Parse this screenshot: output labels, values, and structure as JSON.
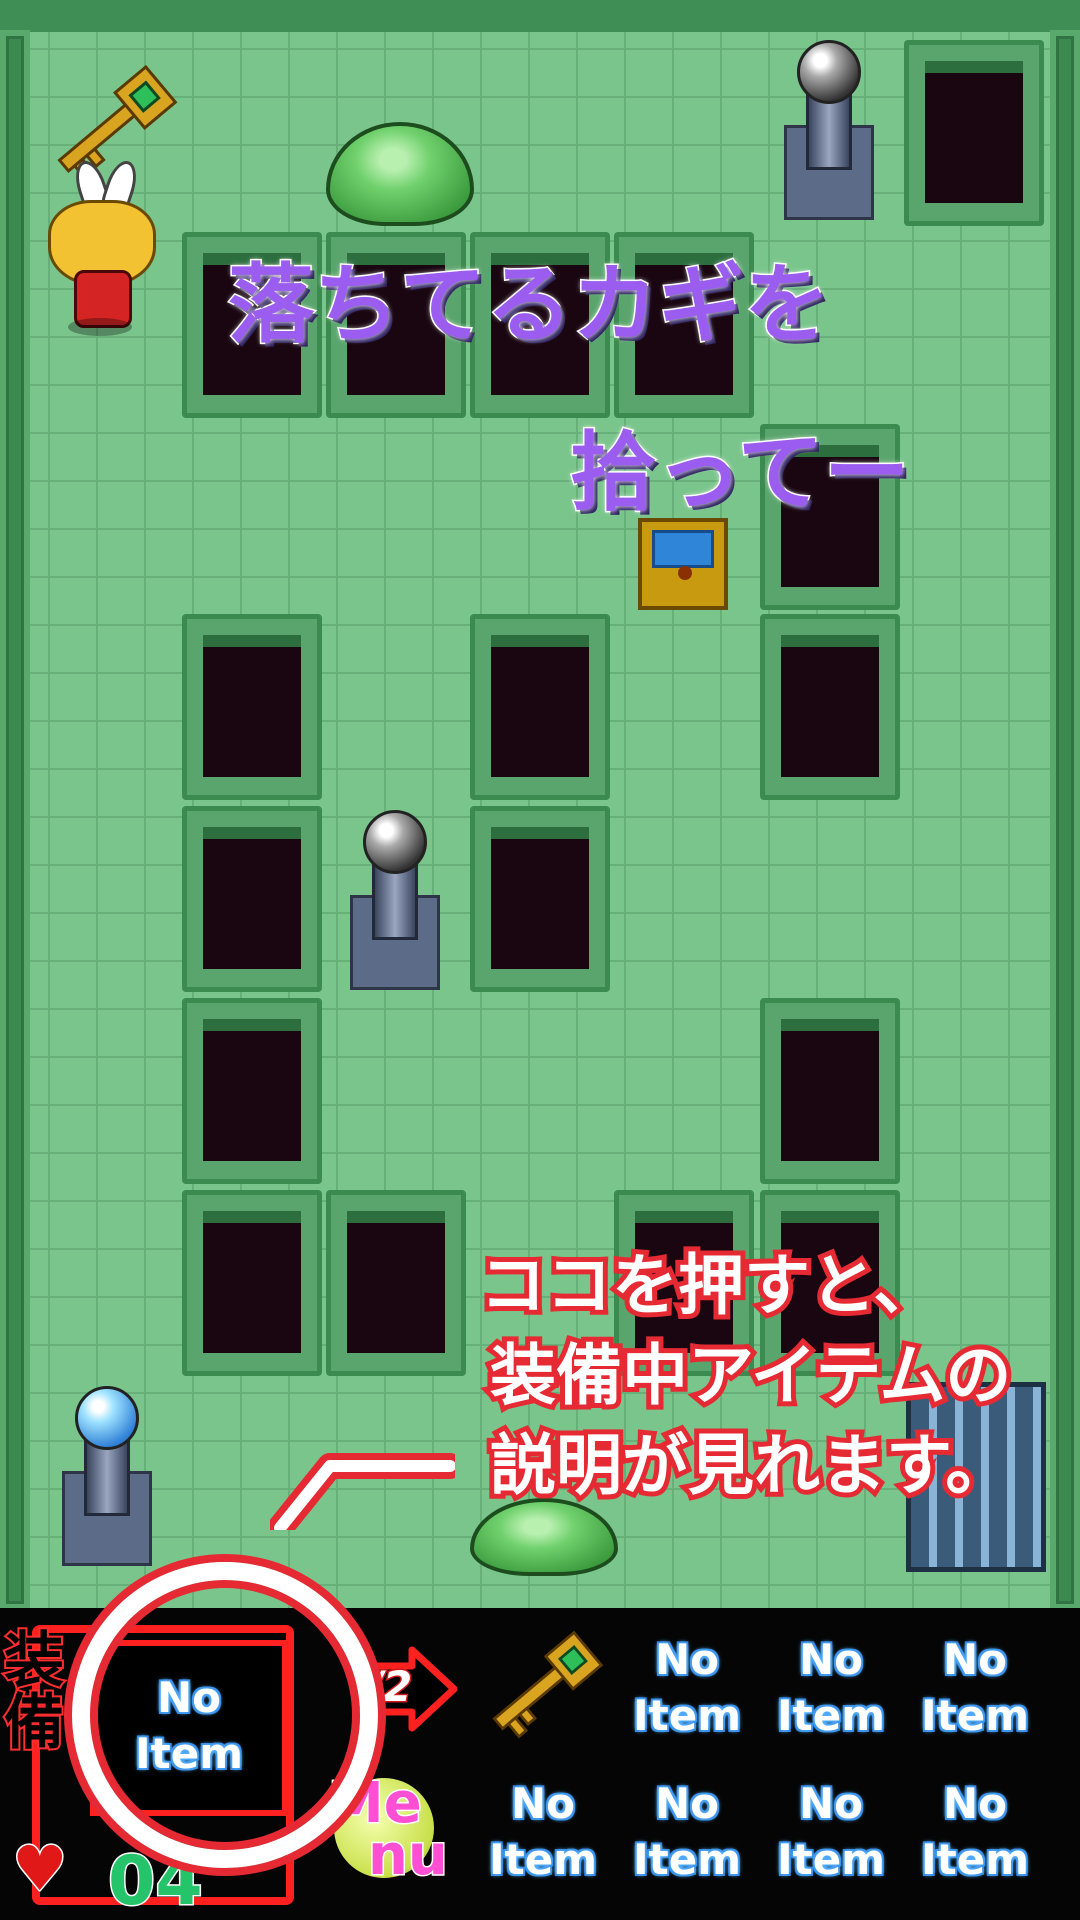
{
  "captions": {
    "key_hint_line1": "落ちてるカギを",
    "key_hint_line2": "拾ってー",
    "equip_hint_line1": "ココを押すと、",
    "equip_hint_line2": "装備中アイテムの",
    "equip_hint_line3": "説明が見れます。"
  },
  "hud": {
    "equip_side_label": "装備",
    "equip_slot": {
      "line1": "No",
      "line2": "Item"
    },
    "page_indicator": "/2",
    "lives": "04",
    "menu_label_top": "Me",
    "menu_label_bottom": "nu",
    "inventory_slots": [
      {
        "kind": "key-icon"
      },
      {
        "line1": "No",
        "line2": "Item"
      },
      {
        "line1": "No",
        "line2": "Item"
      },
      {
        "line1": "No",
        "line2": "Item"
      },
      {
        "line1": "No",
        "line2": "Item"
      },
      {
        "line1": "No",
        "line2": "Item"
      },
      {
        "line1": "No",
        "line2": "Item"
      },
      {
        "line1": "No",
        "line2": "Item"
      }
    ]
  },
  "colors": {
    "floor": "#7ac58c",
    "caption_purple": "#9b5cf0",
    "caption_red": "#e52a33",
    "hud_bg": "#050505",
    "no_item_glow": "#5bb6ff"
  }
}
